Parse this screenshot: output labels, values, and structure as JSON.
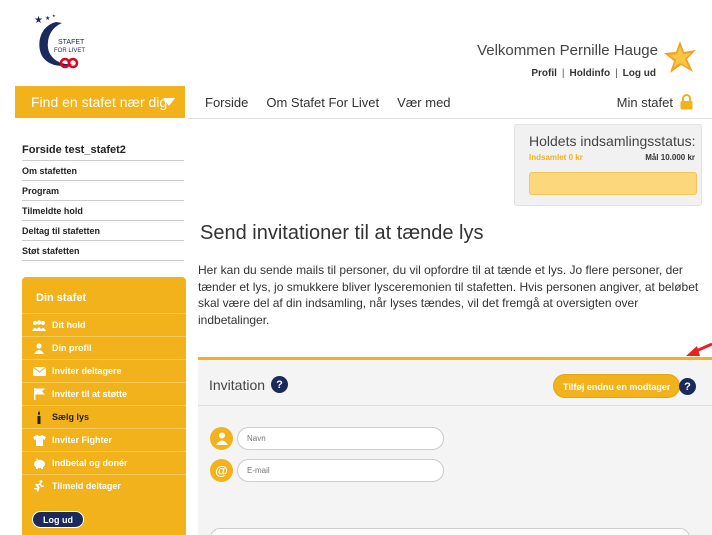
{
  "logo": {
    "line1": "STAFET",
    "line2": "FOR LIVET",
    "icon": "stafet-for-livet-logo"
  },
  "header": {
    "welcome": "Velkommen Pernille Hauge",
    "links": [
      "Profil",
      "Holdinfo",
      "Log ud"
    ],
    "star_icon": "star-icon"
  },
  "nav": {
    "find": "Find en stafet nær dig",
    "items": [
      "Forside",
      "Om Stafet For Livet",
      "Vær med"
    ],
    "min_stafet": "Min stafet"
  },
  "sidebar": {
    "title": "Forside test_stafet2",
    "links": [
      "Om stafetten",
      "Program",
      "Tilmeldte hold",
      "Deltag til stafetten",
      "Støt stafetten"
    ]
  },
  "din_stafet": {
    "title": "Din stafet",
    "items": [
      {
        "label": "Dit hold",
        "icon": "team-icon"
      },
      {
        "label": "Din profil",
        "icon": "user-icon"
      },
      {
        "label": "Inviter deltagere",
        "icon": "envelope-icon"
      },
      {
        "label": "Inviter til at støtte",
        "icon": "flag-icon"
      },
      {
        "label": "Sælg lys",
        "icon": "candle-icon",
        "active": true
      },
      {
        "label": "Inviter Fighter",
        "icon": "shirt-icon"
      },
      {
        "label": "Indbetal og donér",
        "icon": "piggy-bank-icon"
      },
      {
        "label": "Tilmeld deltager",
        "icon": "runner-icon"
      }
    ],
    "logout": "Log ud"
  },
  "status": {
    "title": "Holdets indsamlingsstatus:",
    "collected": "Indsamlet 0 kr",
    "goal": "Mål 10.000 kr",
    "progress": 0
  },
  "main": {
    "title": "Send invitationer til at tænde lys",
    "intro": "Her kan du sende mails til personer, du vil opfordre til at tænde et lys. Jo flere personer, der tænder et lys, jo smukkere bliver lysceremonien til stafetten. Hvis personen angiver, at beløbet skal være del af din indsamling, når lyses tændes, vil det fremgå at oversigten over indbetalinger."
  },
  "invitation": {
    "title": "Invitation",
    "help": "?",
    "add_button": "Tilføj endnu en modtager",
    "name_placeholder": "Navn",
    "email_placeholder": "E-mail",
    "email_symbol": "@"
  },
  "colors": {
    "accent": "#f1b21b",
    "navy": "#1a2a5c",
    "arrow": "#e8231f"
  }
}
